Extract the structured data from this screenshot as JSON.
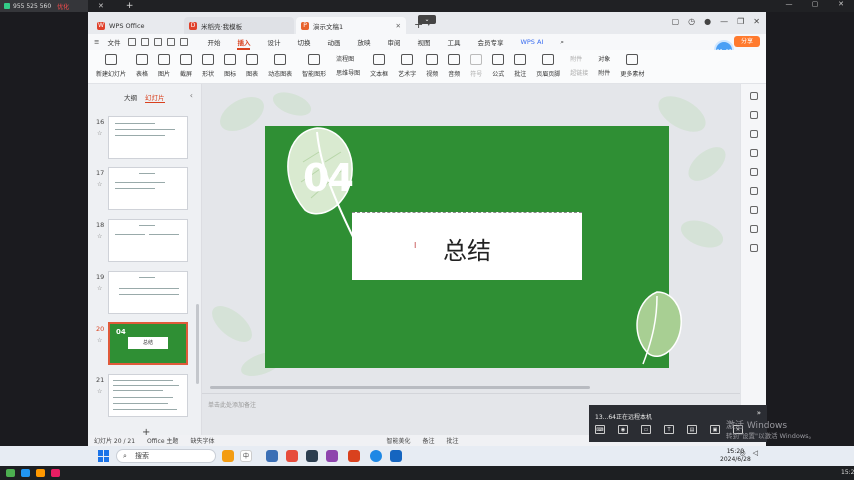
{
  "outer": {
    "tab_title": "955 525 560",
    "tab_status": "优化"
  },
  "wps": {
    "tabs": [
      {
        "label": "WPS Office"
      },
      {
        "label": "米稻壳·我模板"
      },
      {
        "label": "演示文稿1"
      }
    ],
    "menus": [
      "开始",
      "插入",
      "设计",
      "切换",
      "动画",
      "放映",
      "审阅",
      "视图",
      "工具",
      "会员专享"
    ],
    "active_menu": "插入",
    "file_menu": "文件",
    "ai_label": "WPS AI",
    "share_label": "分享",
    "avatar_time": "01:42",
    "ribbon": [
      {
        "label": "新建幻灯片"
      },
      {
        "label": "表格"
      },
      {
        "label": "图片"
      },
      {
        "label": "截屏"
      },
      {
        "label": "形状"
      },
      {
        "label": "图标"
      },
      {
        "label": "图表"
      },
      {
        "label": "动态图表"
      },
      {
        "label": "智能图形"
      }
    ],
    "ribbon_small_1": [
      "流程图",
      "思维导图"
    ],
    "ribbon_2": [
      {
        "label": "文本框"
      },
      {
        "label": "艺术字"
      },
      {
        "label": "视频"
      },
      {
        "label": "音频"
      },
      {
        "label": "符号"
      },
      {
        "label": "公式"
      },
      {
        "label": "批注"
      },
      {
        "label": "页眉页脚"
      }
    ],
    "ribbon_small_2": [
      "附件",
      "超链接"
    ],
    "ribbon_small_3": [
      "对象",
      "附件"
    ],
    "more_label": "更多素材"
  },
  "sidebar": {
    "tabs": [
      "大纲",
      "幻灯片"
    ],
    "active_tab": "幻灯片",
    "slides": [
      {
        "num": "16"
      },
      {
        "num": "17"
      },
      {
        "num": "18"
      },
      {
        "num": "19"
      },
      {
        "num": "20"
      },
      {
        "num": "21"
      }
    ],
    "selected": "20",
    "thumb_20_num": "04",
    "thumb_20_title": "总结"
  },
  "slide": {
    "number": "04",
    "title": "总结"
  },
  "notes_placeholder": "单击此处添加备注",
  "status": {
    "slide_count": "幻灯片 20 / 21",
    "theme": "Office 主题",
    "font_missing": "缺失字体",
    "smart": "智能美化",
    "notes": "备注",
    "comments": "批注"
  },
  "remote": {
    "title": "13...64正在远程本机"
  },
  "watermark": {
    "line1": "激活 Windows",
    "line2": "转到\"设置\"以激活 Windows。"
  },
  "taskbar": {
    "search": "搜索",
    "ime": "中",
    "time": "15:20",
    "date": "2024/6/28",
    "outer_time": "15:20"
  },
  "colors": {
    "accent": "#d9411e",
    "slide_green": "#2f8f34",
    "share": "#ff7a2e"
  }
}
